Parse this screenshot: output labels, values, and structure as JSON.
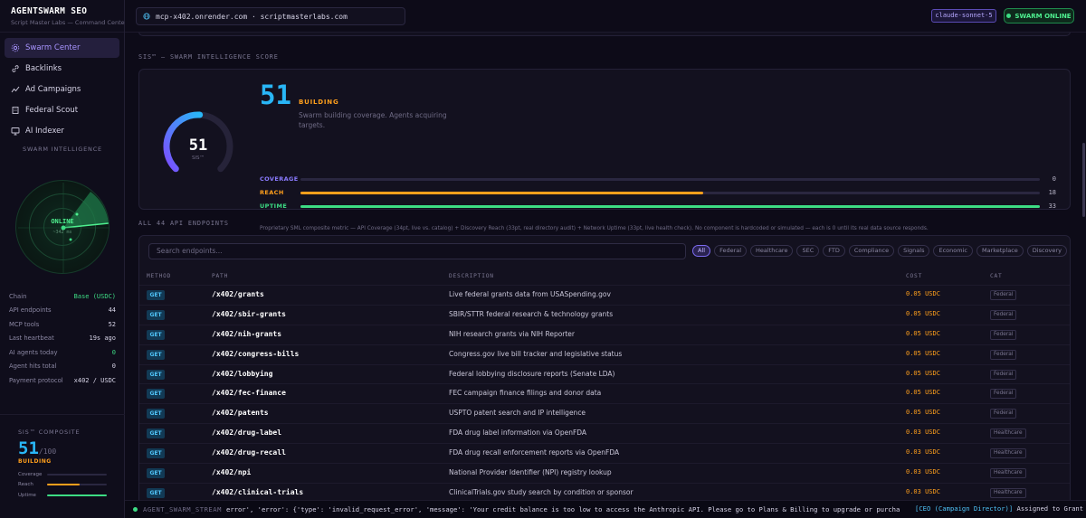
{
  "brand": {
    "title": "AGENTSWARM SEO",
    "subtitle": "Script Master Labs — Command Center"
  },
  "nav": [
    {
      "label": "Swarm Center",
      "icon": "swarm-icon",
      "active": true
    },
    {
      "label": "Backlinks",
      "icon": "link-icon"
    },
    {
      "label": "Ad Campaigns",
      "icon": "chart-line-icon"
    },
    {
      "label": "Federal Scout",
      "icon": "building-icon"
    },
    {
      "label": "AI Indexer",
      "icon": "monitor-icon"
    }
  ],
  "swarm_intel": {
    "title": "SWARM INTELLIGENCE",
    "status": "ONLINE",
    "sub": "~342 ms"
  },
  "stats": [
    {
      "label": "Chain",
      "value": "Base (USDC)",
      "accent": "green"
    },
    {
      "label": "API endpoints",
      "value": "44"
    },
    {
      "label": "MCP tools",
      "value": "52"
    },
    {
      "label": "Last heartbeat",
      "value": "19s ago"
    },
    {
      "label": "AI agents today",
      "value": "0",
      "accent": "green"
    },
    {
      "label": "Agent hits total",
      "value": "0"
    },
    {
      "label": "Payment protocol",
      "value": "x402 / USDC"
    }
  ],
  "composite": {
    "title": "SIS™ COMPOSITE",
    "score": "51",
    "max": "/100",
    "status": "BUILDING",
    "bars": [
      {
        "label": "Coverage",
        "value": 0,
        "color": "#7c6bf0"
      },
      {
        "label": "Reach",
        "value": 0.55,
        "color": "#ff9f1c"
      },
      {
        "label": "Uptime",
        "value": 1,
        "color": "#3ddc84"
      }
    ]
  },
  "topbar": {
    "url": "mcp-x402.onrender.com · scriptmasterlabs.com",
    "model": "claude-sonnet-5",
    "status": "SWARM ONLINE"
  },
  "sis": {
    "section_title": "SIS™ — SWARM INTELLIGENCE SCORE",
    "score": "51",
    "gauge_label": "SIS™",
    "gauge_value": 0.51,
    "status": "BUILDING",
    "description": "Swarm building coverage. Agents acquiring targets.",
    "bars": [
      {
        "label": "COVERAGE",
        "value": 0,
        "fraction": 0,
        "color": "#8b7bff"
      },
      {
        "label": "REACH",
        "value": 18,
        "fraction": 0.545,
        "color": "#ff9f1c"
      },
      {
        "label": "UPTIME",
        "value": 33,
        "fraction": 1,
        "color": "#3ddc84"
      }
    ],
    "footnote": "Proprietary SML composite metric — API Coverage (34pt, live vs. catalog) + Discovery Reach (33pt, real directory audit) + Network Uptime (33pt, live health check). No component is hardcoded or simulated — each is 0 until its real data source responds."
  },
  "endpoints": {
    "section_title": "ALL 44 API ENDPOINTS",
    "search_placeholder": "Search endpoints...",
    "chips": [
      "All",
      "Federal",
      "Healthcare",
      "SEC",
      "FTD",
      "Compliance",
      "Signals",
      "Economic",
      "Marketplace",
      "Discovery"
    ],
    "columns": [
      "METHOD",
      "PATH",
      "DESCRIPTION",
      "COST",
      "CAT"
    ],
    "rows": [
      {
        "method": "GET",
        "path": "/x402/grants",
        "desc": "Live federal grants data from USASpending.gov",
        "cost": "0.05 USDC",
        "cat": "Federal"
      },
      {
        "method": "GET",
        "path": "/x402/sbir-grants",
        "desc": "SBIR/STTR federal research & technology grants",
        "cost": "0.05 USDC",
        "cat": "Federal"
      },
      {
        "method": "GET",
        "path": "/x402/nih-grants",
        "desc": "NIH research grants via NIH Reporter",
        "cost": "0.05 USDC",
        "cat": "Federal"
      },
      {
        "method": "GET",
        "path": "/x402/congress-bills",
        "desc": "Congress.gov live bill tracker and legislative status",
        "cost": "0.05 USDC",
        "cat": "Federal"
      },
      {
        "method": "GET",
        "path": "/x402/lobbying",
        "desc": "Federal lobbying disclosure reports (Senate LDA)",
        "cost": "0.05 USDC",
        "cat": "Federal"
      },
      {
        "method": "GET",
        "path": "/x402/fec-finance",
        "desc": "FEC campaign finance filings and donor data",
        "cost": "0.05 USDC",
        "cat": "Federal"
      },
      {
        "method": "GET",
        "path": "/x402/patents",
        "desc": "USPTO patent search and IP intelligence",
        "cost": "0.05 USDC",
        "cat": "Federal"
      },
      {
        "method": "GET",
        "path": "/x402/drug-label",
        "desc": "FDA drug label information via OpenFDA",
        "cost": "0.03 USDC",
        "cat": "Healthcare"
      },
      {
        "method": "GET",
        "path": "/x402/drug-recall",
        "desc": "FDA drug recall enforcement reports via OpenFDA",
        "cost": "0.03 USDC",
        "cat": "Healthcare"
      },
      {
        "method": "GET",
        "path": "/x402/npi",
        "desc": "National Provider Identifier (NPI) registry lookup",
        "cost": "0.03 USDC",
        "cat": "Healthcare"
      },
      {
        "method": "GET",
        "path": "/x402/clinical-trials",
        "desc": "ClinicalTrials.gov study search by condition or sponsor",
        "cost": "0.03 USDC",
        "cat": "Healthcare"
      }
    ]
  },
  "stream": {
    "label": "AGENT_SWARM_STREAM",
    "message": "error', 'error': {'type': 'invalid_request_error', 'message': 'Your credit balance is too low to access the Anthropic API. Please go to Plans & Billing to upgrade or purcha",
    "tail_tag": "[CEO (Campaign Director)]",
    "tail_text": " Assigned to Grant"
  }
}
